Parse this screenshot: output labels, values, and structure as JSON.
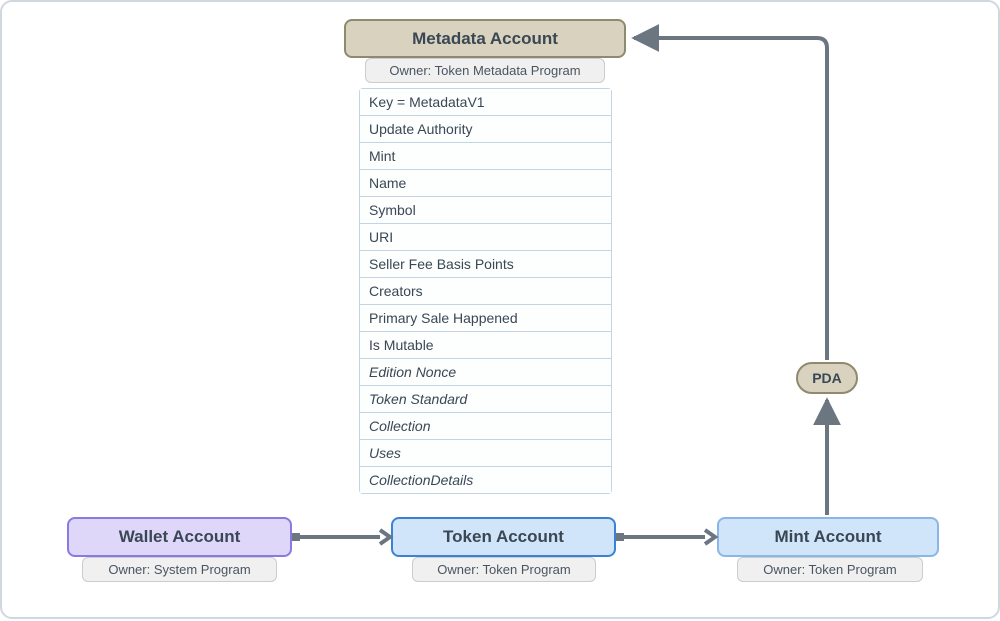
{
  "metadata": {
    "title": "Metadata Account",
    "owner": "Owner: Token Metadata Program",
    "fields": [
      {
        "label": "Key = MetadataV1",
        "italic": false
      },
      {
        "label": "Update Authority",
        "italic": false
      },
      {
        "label": "Mint",
        "italic": false
      },
      {
        "label": "Name",
        "italic": false
      },
      {
        "label": "Symbol",
        "italic": false
      },
      {
        "label": "URI",
        "italic": false
      },
      {
        "label": "Seller Fee Basis Points",
        "italic": false
      },
      {
        "label": "Creators",
        "italic": false
      },
      {
        "label": "Primary Sale Happened",
        "italic": false
      },
      {
        "label": "Is Mutable",
        "italic": false
      },
      {
        "label": "Edition Nonce",
        "italic": true
      },
      {
        "label": "Token Standard",
        "italic": true
      },
      {
        "label": "Collection",
        "italic": true
      },
      {
        "label": "Uses",
        "italic": true
      },
      {
        "label": "CollectionDetails",
        "italic": true
      }
    ]
  },
  "wallet": {
    "title": "Wallet Account",
    "owner": "Owner: System Program"
  },
  "token": {
    "title": "Token Account",
    "owner": "Owner: Token Program"
  },
  "mint": {
    "title": "Mint Account",
    "owner": "Owner: Token Program"
  },
  "pda": {
    "label": "PDA"
  },
  "arrows": {
    "wallet_to_token": true,
    "token_to_mint": true,
    "mint_to_pda": true,
    "pda_to_metadata": true
  }
}
